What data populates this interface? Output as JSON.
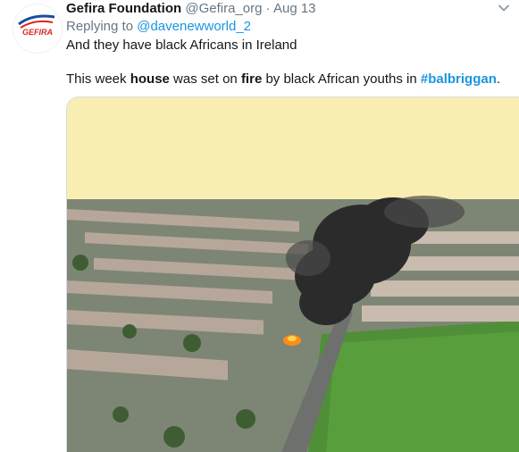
{
  "tweet": {
    "author_name": "Gefira Foundation",
    "author_handle": "@Gefira_org",
    "separator": "·",
    "date": "Aug 13",
    "replying_prefix": "Replying to",
    "replying_handle": "@davenewworld_2",
    "line1": "And they have black Africans in Ireland",
    "line2": {
      "t1": "This week ",
      "b1": "house",
      "t2": " was set on ",
      "b2": "fire",
      "t3": " by black African youths in ",
      "hashtag": "#balbriggan",
      "t4": "."
    }
  },
  "avatar": {
    "logo_text": "GEFIRA"
  },
  "icons": {
    "menu": "chevron-down-icon"
  },
  "colors": {
    "link": "#1b95e0",
    "muted": "#657786",
    "media_bg": "#f8eeb1"
  }
}
